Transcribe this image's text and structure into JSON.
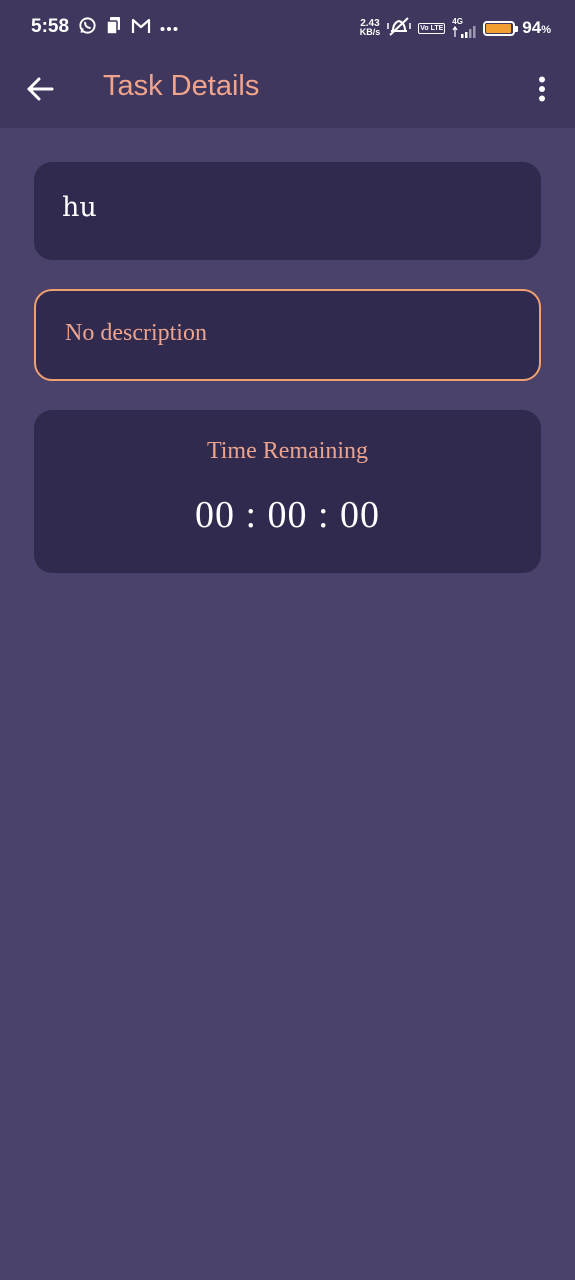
{
  "status_bar": {
    "time": "5:58",
    "left_icons": [
      "whatsapp-icon",
      "sim-card-icon",
      "gmail-icon",
      "more-dots-icon"
    ],
    "net_speed_value": "2.43",
    "net_speed_unit": "KB/s",
    "network_type": "4G",
    "volte_label": "Vo LTE",
    "battery_percent": "94",
    "battery_percent_sign": "%",
    "battery_level": 0.94,
    "battery_color": "#f0a030"
  },
  "app_bar": {
    "title": "Task Details",
    "back_icon": "arrow-back-icon",
    "menu_icon": "more-vert-icon"
  },
  "task": {
    "title": "hu",
    "description": "No description"
  },
  "timer": {
    "label": "Time Remaining",
    "value": "00 : 00 : 00"
  },
  "colors": {
    "background": "#4a426b",
    "app_bar": "#3f375d",
    "card": "#302a4f",
    "accent": "#f0a48c",
    "description_border": "#f0a070"
  }
}
